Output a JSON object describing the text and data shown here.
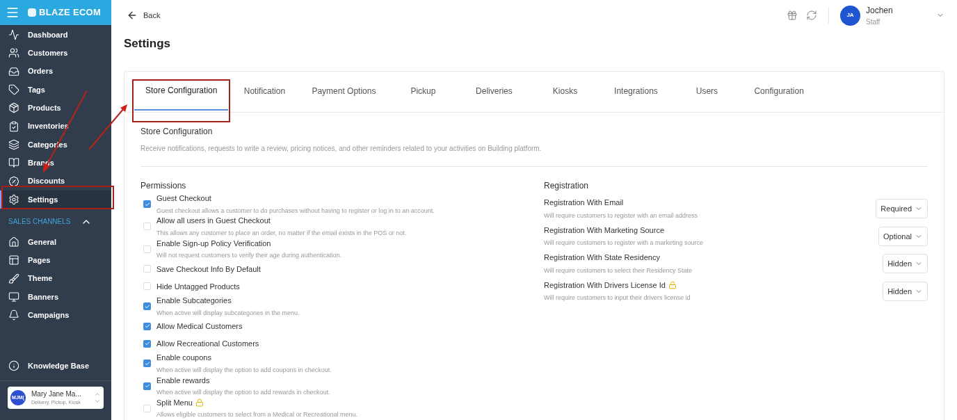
{
  "sidebar": {
    "brand": "BLAZE ECOM",
    "items": [
      {
        "label": "Dashboard",
        "selected": false
      },
      {
        "label": "Customers",
        "selected": false
      },
      {
        "label": "Orders",
        "selected": false
      },
      {
        "label": "Tags",
        "selected": false
      },
      {
        "label": "Products",
        "selected": false
      },
      {
        "label": "Inventories",
        "selected": false
      },
      {
        "label": "Categories",
        "selected": false
      },
      {
        "label": "Brands",
        "selected": false
      },
      {
        "label": "Discounts",
        "selected": false
      },
      {
        "label": "Settings",
        "selected": true
      }
    ],
    "section": {
      "title": "SALES CHANNELS",
      "expanded": true,
      "items": [
        {
          "label": "General"
        },
        {
          "label": "Pages"
        },
        {
          "label": "Theme"
        },
        {
          "label": "Banners"
        },
        {
          "label": "Campaigns"
        }
      ]
    },
    "help": {
      "label": "Knowledge Base"
    },
    "account": {
      "initials": "MJM(",
      "name": "Mary Jane Ma...",
      "subtitle": "Delivery, Pickup, Kiosk"
    }
  },
  "header": {
    "back": "Back",
    "user": {
      "initials": "JA",
      "name": "Jochen",
      "role": "Staff"
    }
  },
  "title": "Settings",
  "tabs": [
    {
      "label": "Store Configuration",
      "selected": true
    },
    {
      "label": "Notification",
      "selected": false
    },
    {
      "label": "Payment Options",
      "selected": false
    },
    {
      "label": "Pickup",
      "selected": false
    },
    {
      "label": "Deliveries",
      "selected": false
    },
    {
      "label": "Kiosks",
      "selected": false
    },
    {
      "label": "Integrations",
      "selected": false
    },
    {
      "label": "Users",
      "selected": false
    },
    {
      "label": "Configuration",
      "selected": false
    }
  ],
  "section": {
    "title": "Store Configuration",
    "description": "Receive notifications, requests to write a review, pricing notices, and other reminders related to your activities on Building platform."
  },
  "permissions": {
    "title": "Permissions",
    "items": [
      {
        "label": "Guest Checkout",
        "hint": "Guest checkout allows a customer to do purchases without having to register or log in to an account.",
        "checked": true
      },
      {
        "label": "Allow all users in Guest Checkout",
        "hint": "This allows any customer to place an order, no matter if the email exists in the POS or not.",
        "checked": false
      },
      {
        "label": "Enable Sign-up Policy Verification",
        "hint": "Will not request customers to verify their age during authentication.",
        "checked": false
      },
      {
        "label": "Save Checkout Info By Default",
        "checked": false
      },
      {
        "label": "Hide Untagged Products",
        "checked": false
      },
      {
        "label": "Enable Subcategories",
        "hint": "When active will display subcategories in the menu.",
        "checked": true
      },
      {
        "label": "Allow Medical Customers",
        "checked": true
      },
      {
        "label": "Allow Recreational Customers",
        "checked": true
      },
      {
        "label": "Enable coupons",
        "hint": "When active will display the option to add coupons in checkout.",
        "checked": true
      },
      {
        "label": "Enable rewards",
        "hint": "When active will display the option to add rewards in checkout.",
        "checked": true
      },
      {
        "label": "Split Menu",
        "hint": "Allows eligible customers to select from a Medical or Recreational menu.",
        "checked": false,
        "locked": true
      }
    ]
  },
  "registration": {
    "title": "Registration",
    "items": [
      {
        "label": "Registration With Email",
        "hint": "Will require customers to register with an email address",
        "value": "Required"
      },
      {
        "label": "Registration With Marketing Source",
        "hint": "Will require customers to register with a marketing source",
        "value": "Optional"
      },
      {
        "label": "Registration With State Residency",
        "hint": "Will require customers to select their Residency State",
        "value": "Hidden"
      },
      {
        "label": "Registration With Drivers License Id",
        "hint": "Will require customers to input their drivers license id",
        "value": "Hidden",
        "locked": true
      }
    ]
  }
}
